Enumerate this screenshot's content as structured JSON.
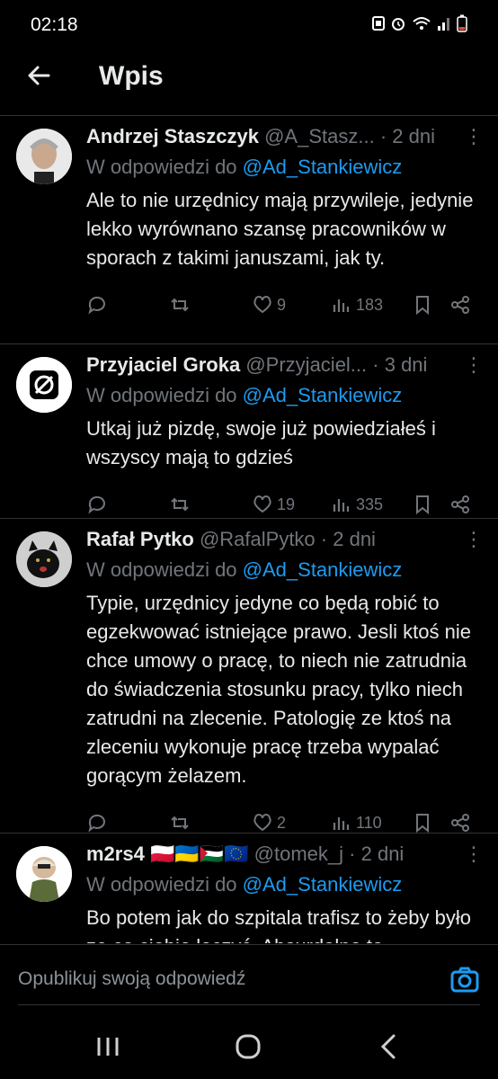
{
  "status_bar": {
    "time": "02:18"
  },
  "header": {
    "title": "Wpis"
  },
  "posts": [
    {
      "name": "Andrzej Staszczyk",
      "handle": "@A_Stasz...",
      "date": "· 2 dni",
      "reply_label": "W odpowiedzi do",
      "reply_to": "@Ad_Stankiewicz",
      "text": "Ale to nie urzędnicy mają przywileje, jedynie lekko wyrównano szansę pracowników w sporach z takimi januszami, jak ty.",
      "likes": "9",
      "views": "183"
    },
    {
      "name": "Przyjaciel Groka",
      "handle": "@Przyjaciel...",
      "date": "· 3 dni",
      "reply_label": "W odpowiedzi do",
      "reply_to": "@Ad_Stankiewicz",
      "text": "Utkaj już pizdę, swoje już powiedziałeś i wszyscy mają to gdzieś",
      "likes": "19",
      "views": "335"
    },
    {
      "name": "Rafał Pytko",
      "handle": "@RafalPytko",
      "date": "· 2 dni",
      "reply_label": "W odpowiedzi do",
      "reply_to": "@Ad_Stankiewicz",
      "text": "Typie, urzędnicy jedyne co będą robić to egzekwować istniejące prawo. Jesli ktoś nie chce umowy o pracę, to niech nie zatrudnia do świadczenia stosunku pracy, tylko niech zatrudni na zlecenie. Patologię ze ktoś na zleceniu wykonuje pracę trzeba wypalać gorącym żelazem.",
      "likes": "2",
      "views": "110"
    },
    {
      "name": "m2rs4",
      "flags": "🇵🇱🇺🇦🇵🇸🇪🇺",
      "handle": "@tomek_j",
      "date": "· 2 dni",
      "reply_label": "W odpowiedzi do",
      "reply_to": "@Ad_Stankiewicz",
      "text": "Bo potem jak do szpitala trafisz to żeby było ze co ciebie leczyć. Absurdalne to"
    }
  ],
  "reply_bar": {
    "placeholder": "Opublikuj swoją odpowiedź"
  },
  "colors": {
    "accent": "#1d9bf0",
    "muted": "#71767b",
    "text": "#e7e9ea",
    "background": "#000000",
    "divider": "#2f3336"
  }
}
